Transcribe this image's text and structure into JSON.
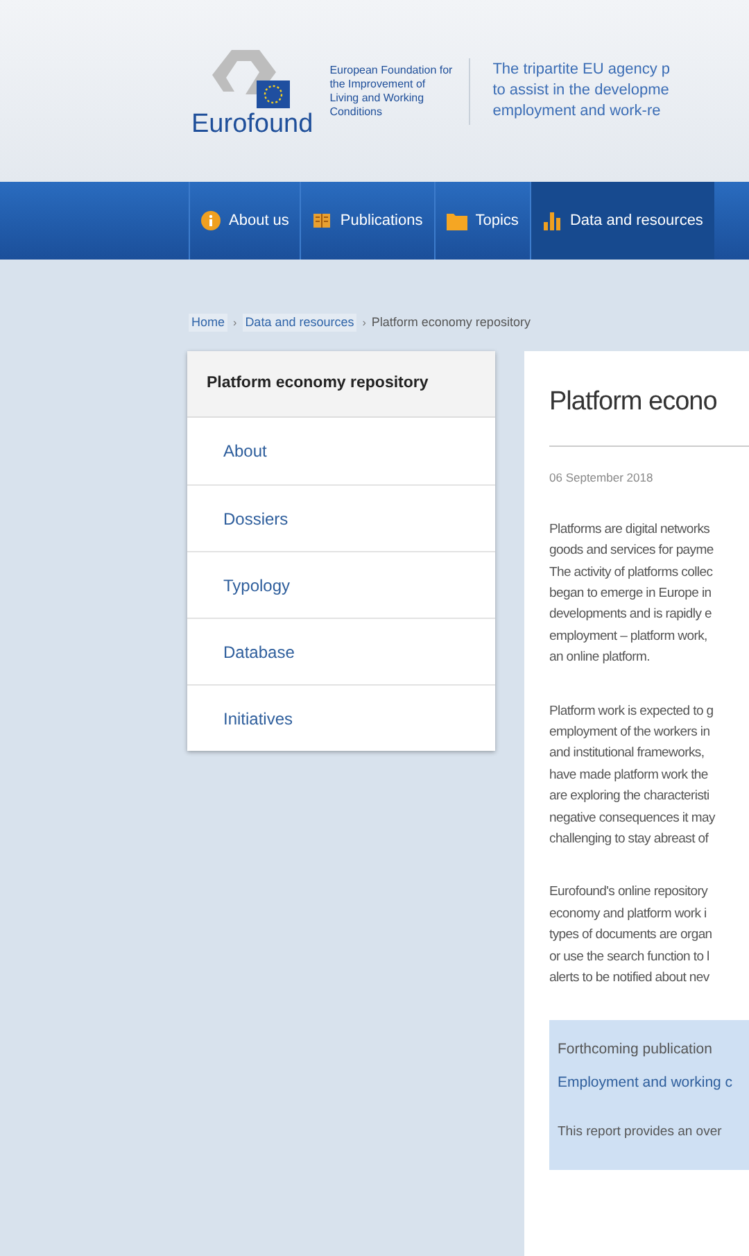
{
  "header": {
    "logo_text": "Eurofound",
    "org_name": [
      "European Foundation for",
      "the Improvement of",
      "Living and Working",
      "Conditions"
    ],
    "tagline": [
      "The tripartite EU agency p",
      "to assist in the developme",
      "employment and work-re"
    ]
  },
  "nav": [
    {
      "label": "About us",
      "kind": "info",
      "selected": false
    },
    {
      "label": "Publications",
      "kind": "book",
      "selected": false
    },
    {
      "label": "Topics",
      "kind": "folder",
      "selected": false
    },
    {
      "label": "Data and resources",
      "kind": "chart",
      "selected": true
    }
  ],
  "breadcrumb": [
    "Home",
    "›",
    "Data and resources",
    "›",
    "Platform economy repository"
  ],
  "sidebar": {
    "title": "Platform economy repository",
    "items": [
      "About",
      "Dossiers",
      "Typology",
      "Database",
      "Initiatives"
    ]
  },
  "article": {
    "title": "Platform econo",
    "date": "06 September 2018",
    "paragraphs": [
      [
        "Platforms are digital networks",
        "goods and services for payme",
        "The activity of platforms collec",
        "began to emerge in Europe in",
        "developments and is rapidly e",
        "employment – platform work,",
        "an online platform."
      ],
      [
        "Platform work is expected to g",
        "employment of the workers in",
        "and institutional frameworks,",
        "have made platform work the",
        "are exploring the characteristi",
        "negative consequences it may",
        "challenging to stay abreast of"
      ],
      [
        "Eurofound's online repository",
        "economy and platform work i",
        "types of documents are organ",
        "or use the search function to l",
        "alerts to be notified about nev"
      ]
    ],
    "callout": {
      "label": "Forthcoming publication",
      "link": "Employment and working c",
      "text": "This report provides an over"
    }
  }
}
